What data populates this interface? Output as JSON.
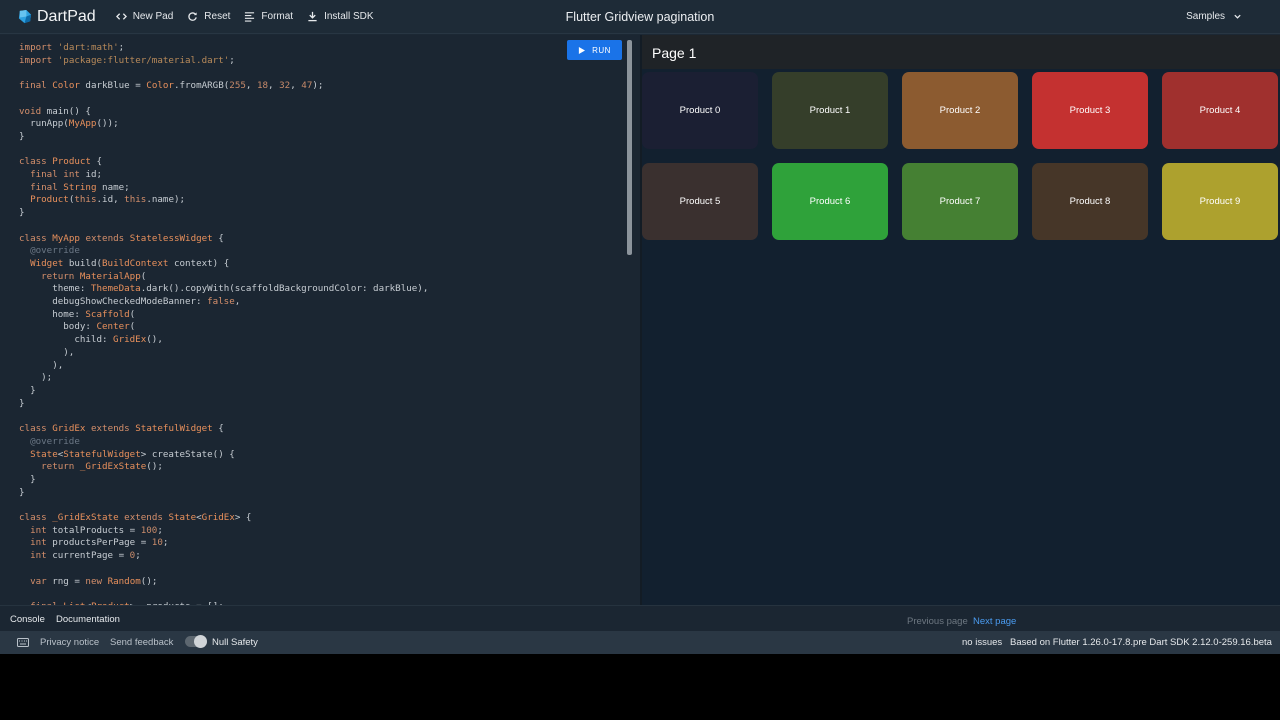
{
  "header": {
    "app_name": "DartPad",
    "new_pad": "New Pad",
    "reset": "Reset",
    "format": "Format",
    "install_sdk": "Install SDK",
    "title": "Flutter Gridview pagination",
    "samples": "Samples"
  },
  "editor": {
    "run_label": "RUN",
    "code_lines": [
      "import 'dart:math';",
      "import 'package:flutter/material.dart';",
      "",
      "final Color darkBlue = Color.fromARGB(255, 18, 32, 47);",
      "",
      "void main() {",
      "  runApp(MyApp());",
      "}",
      "",
      "class Product {",
      "  final int id;",
      "  final String name;",
      "  Product(this.id, this.name);",
      "}",
      "",
      "class MyApp extends StatelessWidget {",
      "  @override",
      "  Widget build(BuildContext context) {",
      "    return MaterialApp(",
      "      theme: ThemeData.dark().copyWith(scaffoldBackgroundColor: darkBlue),",
      "      debugShowCheckedModeBanner: false,",
      "      home: Scaffold(",
      "        body: Center(",
      "          child: GridEx(),",
      "        ),",
      "      ),",
      "    );",
      "  }",
      "}",
      "",
      "class GridEx extends StatefulWidget {",
      "  @override",
      "  State<StatefulWidget> createState() {",
      "    return _GridExState();",
      "  }",
      "}",
      "",
      "class _GridExState extends State<GridEx> {",
      "  int totalProducts = 100;",
      "  int productsPerPage = 10;",
      "  int currentPage = 0;",
      "",
      "  var rng = new Random();",
      "",
      "  final List<Product> _products = [];"
    ]
  },
  "output": {
    "page_title": "Page 1",
    "products": [
      {
        "label": "Product 0",
        "color": "#1b1f33"
      },
      {
        "label": "Product 1",
        "color": "#353e2a"
      },
      {
        "label": "Product 2",
        "color": "#8c5b30"
      },
      {
        "label": "Product 3",
        "color": "#c43130"
      },
      {
        "label": "Product 4",
        "color": "#a0302e"
      },
      {
        "label": "Product 5",
        "color": "#3a302f"
      },
      {
        "label": "Product 6",
        "color": "#2fa23a"
      },
      {
        "label": "Product 7",
        "color": "#458033"
      },
      {
        "label": "Product 8",
        "color": "#463628"
      },
      {
        "label": "Product 9",
        "color": "#ada12e"
      }
    ],
    "previous_page": "Previous page",
    "next_page": "Next page"
  },
  "console_bar": {
    "console": "Console",
    "documentation": "Documentation"
  },
  "footer": {
    "privacy_notice": "Privacy notice",
    "send_feedback": "Send feedback",
    "null_safety": "Null Safety",
    "issues": "no issues",
    "sdk_info": "Based on Flutter 1.26.0-17.8.pre Dart SDK 2.12.0-259.16.beta"
  },
  "colors": {
    "accent": "#1a73e8",
    "header_bg": "#1e2b37",
    "editor_bg": "#1b2632",
    "output_bg": "#12202f",
    "appbar_bg": "#1f2327",
    "link_active": "#4a9bf0",
    "link_disabled": "#6d7781"
  },
  "icons": {
    "logo": "dart-logo-icon",
    "new_pad": "code-brackets-icon",
    "reset": "refresh-icon",
    "format": "align-left-icon",
    "install": "download-icon",
    "samples": "chevron-down-icon",
    "run": "play-icon",
    "keyboard": "keyboard-icon"
  }
}
